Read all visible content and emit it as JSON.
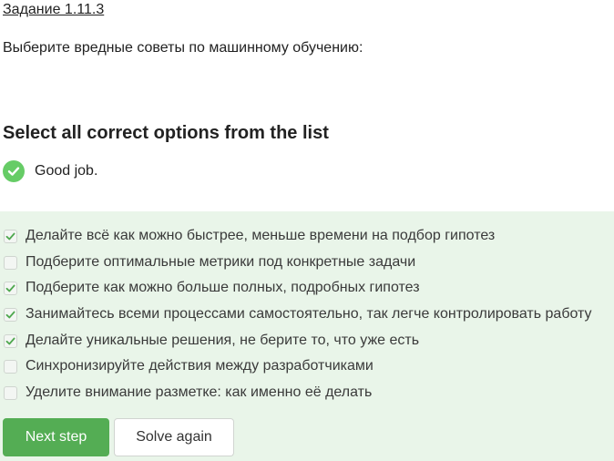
{
  "task": {
    "link_text": "Задание 1.11.3",
    "question": "Выберите вредные советы по машинному обучению:"
  },
  "quiz": {
    "instruction": "Select all correct options from the list",
    "feedback": {
      "icon": "check-circle-icon",
      "text": "Good job.",
      "color": "#66cc66"
    },
    "panel_color": "#e9f5e9",
    "options": [
      {
        "label": "Делайте всё как можно быстрее, меньше времени на подбор гипотез",
        "checked": true
      },
      {
        "label": "Подберите оптимальные метрики под конкретные задачи",
        "checked": false
      },
      {
        "label": "Подберите как можно больше полных, подробных гипотез",
        "checked": true
      },
      {
        "label": "Занимайтесь всеми процессами самостоятельно, так легче контролировать работу",
        "checked": true
      },
      {
        "label": "Делайте уникальные решения, не берите то, что уже есть",
        "checked": true
      },
      {
        "label": "Синхронизируйте действия между разработчиками",
        "checked": false
      },
      {
        "label": "Уделите внимание разметке: как именно её делать",
        "checked": false
      }
    ]
  },
  "actions": {
    "next_label": "Next step",
    "solve_again_label": "Solve again",
    "accent_color": "#54ad54"
  }
}
